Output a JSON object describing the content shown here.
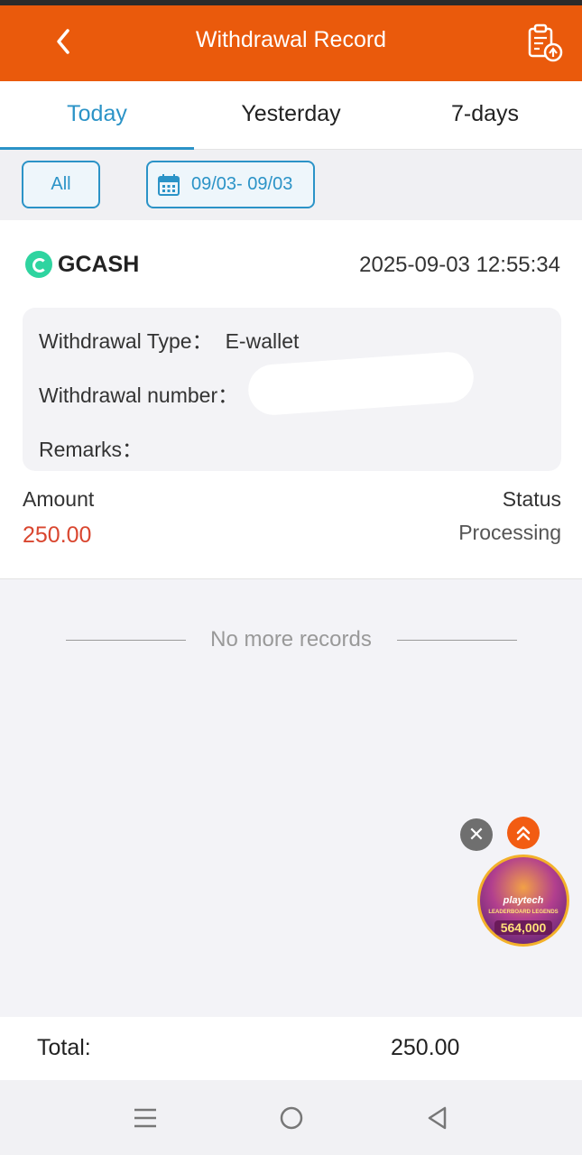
{
  "header": {
    "title": "Withdrawal Record",
    "back_icon": "chevron-left-icon",
    "record_icon": "clipboard-upload-icon",
    "color": "#ea5a0c"
  },
  "tabs": [
    {
      "label": "Today",
      "active": true
    },
    {
      "label": "Yesterday",
      "active": false
    },
    {
      "label": "7-days",
      "active": false
    }
  ],
  "filters": {
    "all_label": "All",
    "date_range": "09/03- 09/03",
    "calendar_icon": "calendar-icon",
    "accent": "#2b93c7"
  },
  "record": {
    "provider": "GCASH",
    "datetime": "2025-09-03 12:55:34",
    "withdrawal_type_label": "Withdrawal Type：",
    "withdrawal_type_value": "E-wallet",
    "withdrawal_number_label": "Withdrawal number：",
    "remarks_label": "Remarks：",
    "amount_label": "Amount",
    "amount_value": "250.00",
    "status_label": "Status",
    "status_value": "Processing",
    "amount_color": "#d9462f"
  },
  "list_end_text": "No more records",
  "promo": {
    "brand": "playtech",
    "subtitle": "LEADERBOARD LEGENDS",
    "amount": "564,000"
  },
  "total": {
    "label": "Total:",
    "value": "250.00"
  },
  "nav": [
    "menu-icon",
    "home-icon",
    "back-icon"
  ]
}
